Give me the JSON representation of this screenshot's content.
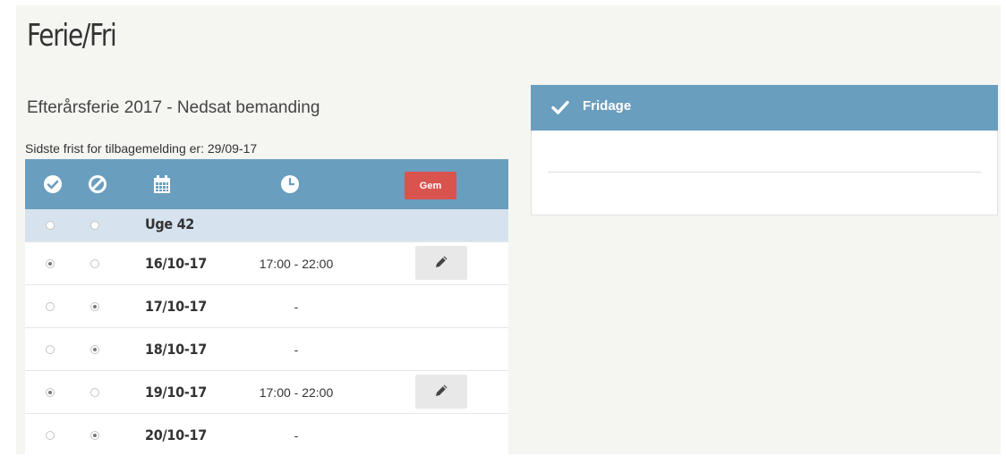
{
  "page": {
    "title": "Ferie/Fri"
  },
  "schedule": {
    "section_title": "Efterårsferie 2017 - Nedsat bemanding",
    "deadline_text": "Sidste frist for tilbagemelding er: 29/09-17",
    "header_icons": [
      "check-circle-icon",
      "ban-icon",
      "calendar-icon",
      "clock-icon"
    ],
    "save_label": "Gem",
    "week_label": "Uge 42",
    "rows": [
      {
        "date": "16/10-17",
        "time": "17:00 - 22:00",
        "attending": true,
        "editable": true
      },
      {
        "date": "17/10-17",
        "time": "-",
        "attending": false,
        "editable": false
      },
      {
        "date": "18/10-17",
        "time": "-",
        "attending": false,
        "editable": false
      },
      {
        "date": "19/10-17",
        "time": "17:00 - 22:00",
        "attending": true,
        "editable": true
      },
      {
        "date": "20/10-17",
        "time": "-",
        "attending": false,
        "editable": false
      }
    ]
  },
  "fridage_panel": {
    "title": "Fridage",
    "icon": "check-icon"
  },
  "colors": {
    "header_blue": "#6a9ebf",
    "week_row": "#d6e3ee",
    "save_red": "#d9534f",
    "edit_grey": "#e8e8e8",
    "background": "#f5f5f2"
  }
}
